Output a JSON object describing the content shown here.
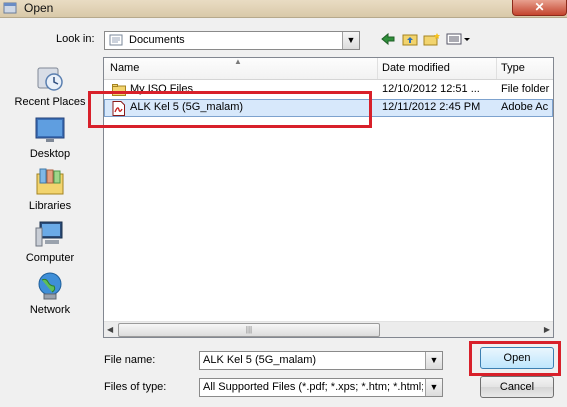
{
  "window": {
    "title": "Open",
    "close_glyph": "✕"
  },
  "lookin": {
    "label": "Look in:",
    "value": "Documents"
  },
  "toolbar": {
    "back_icon": "back-arrow-icon",
    "up_icon": "up-folder-icon",
    "newfolder_icon": "new-folder-icon",
    "views_icon": "views-menu-icon"
  },
  "places": [
    {
      "label": "Recent Places",
      "icon": "recent-places-icon"
    },
    {
      "label": "Desktop",
      "icon": "desktop-icon"
    },
    {
      "label": "Libraries",
      "icon": "libraries-icon"
    },
    {
      "label": "Computer",
      "icon": "computer-icon"
    },
    {
      "label": "Network",
      "icon": "network-icon"
    }
  ],
  "filelist": {
    "columns": [
      "Name",
      "Date modified",
      "Type"
    ],
    "rows": [
      {
        "name": "My ISO Files",
        "date": "12/10/2012 12:51 ...",
        "type": "File folder",
        "icon": "folder-icon"
      },
      {
        "name": "ALK Kel 5 (5G_malam)",
        "date": "12/11/2012 2:45 PM",
        "type": "Adobe Ac",
        "icon": "pdf-icon"
      }
    ]
  },
  "filename": {
    "label": "File name:",
    "value": "ALK Kel 5 (5G_malam)"
  },
  "filetype": {
    "label": "Files of type:",
    "value": "All Supported Files (*.pdf; *.xps; *.htm; *.html; *.t"
  },
  "buttons": {
    "open": "Open",
    "cancel": "Cancel"
  },
  "colors": {
    "highlight": "#d8202a",
    "selection": "#d7e8fb"
  }
}
